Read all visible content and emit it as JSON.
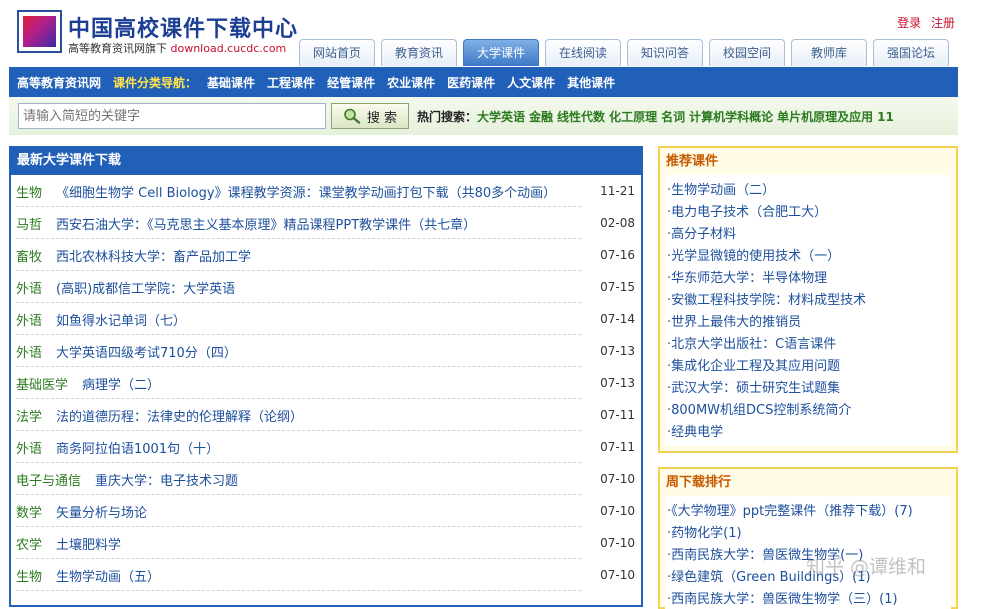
{
  "header": {
    "title": "中国高校课件下载中心",
    "subtitle": "高等教育资讯网旗下",
    "subtitle_url": "download.cucdc.com",
    "login": "登录",
    "register": "注册"
  },
  "tabs": [
    {
      "label": "网站首页",
      "active": false
    },
    {
      "label": "教育资讯",
      "active": false
    },
    {
      "label": "大学课件",
      "active": true
    },
    {
      "label": "在线阅读",
      "active": false
    },
    {
      "label": "知识问答",
      "active": false
    },
    {
      "label": "校园空间",
      "active": false
    },
    {
      "label": "教师库",
      "active": false
    },
    {
      "label": "强国论坛",
      "active": false
    }
  ],
  "navbar": {
    "home": "高等教育资讯网",
    "label": "课件分类导航：",
    "items": [
      "基础课件",
      "工程课件",
      "经管课件",
      "农业课件",
      "医药课件",
      "人文课件",
      "其他课件"
    ]
  },
  "search": {
    "placeholder": "请输入简短的关键字",
    "button": "搜 索",
    "hot_label": "热门搜索：",
    "hot_terms": [
      "大学英语",
      "金融",
      "线性代数",
      "化工原理",
      "名词",
      "计算机学科概论",
      "单片机原理及应用",
      "11"
    ]
  },
  "latest": {
    "title": "最新大学课件下载",
    "items": [
      {
        "cat": "生物",
        "title": "《细胞生物学 Cell Biology》课程教学资源：课堂教学动画打包下载（共80多个动画）",
        "date": "11-21"
      },
      {
        "cat": "马哲",
        "title": "西安石油大学：《马克思主义基本原理》精品课程PPT教学课件（共七章）",
        "date": "02-08"
      },
      {
        "cat": "畜牧",
        "title": "西北农林科技大学：畜产品加工学",
        "date": "07-16"
      },
      {
        "cat": "外语",
        "title": "(高职)成都信工学院：大学英语",
        "date": "07-15"
      },
      {
        "cat": "外语",
        "title": "如鱼得水记单词（七）",
        "date": "07-14"
      },
      {
        "cat": "外语",
        "title": "大学英语四级考试710分（四）",
        "date": "07-13"
      },
      {
        "cat": "基础医学",
        "title": "病理学（二）",
        "date": "07-13"
      },
      {
        "cat": "法学",
        "title": "法的道德历程：法律史的伦理解释（论纲）",
        "date": "07-11"
      },
      {
        "cat": "外语",
        "title": "商务阿拉伯语1001句（十）",
        "date": "07-11"
      },
      {
        "cat": "电子与通信",
        "title": "重庆大学：电子技术习题",
        "date": "07-10"
      },
      {
        "cat": "数学",
        "title": "矢量分析与场论",
        "date": "07-10"
      },
      {
        "cat": "农学",
        "title": "土壤肥料学",
        "date": "07-10"
      },
      {
        "cat": "生物",
        "title": "生物学动画（五）",
        "date": "07-10"
      }
    ]
  },
  "recommended": {
    "title": "推荐课件",
    "items": [
      "生物学动画（二）",
      "电力电子技术（合肥工大）",
      "高分子材料",
      "光学显微镜的使用技术（一）",
      "华东师范大学：半导体物理",
      "安徽工程科技学院：材料成型技术",
      "世界上最伟大的推销员",
      "北京大学出版社：C语言课件",
      "集成化企业工程及其应用问题",
      "武汉大学：硕士研究生试题集",
      "800MW机组DCS控制系统简介",
      "经典电学"
    ]
  },
  "weekly": {
    "title": "周下载排行",
    "items": [
      "《大学物理》ppt完整课件（推荐下载）(7)",
      "药物化学(1)",
      "西南民族大学：兽医微生物学(一)",
      "绿色建筑（Green Buildings）(1)",
      "西南民族大学：兽医微生物学（三）(1)"
    ]
  },
  "watermark": "知乎 @谭维和"
}
